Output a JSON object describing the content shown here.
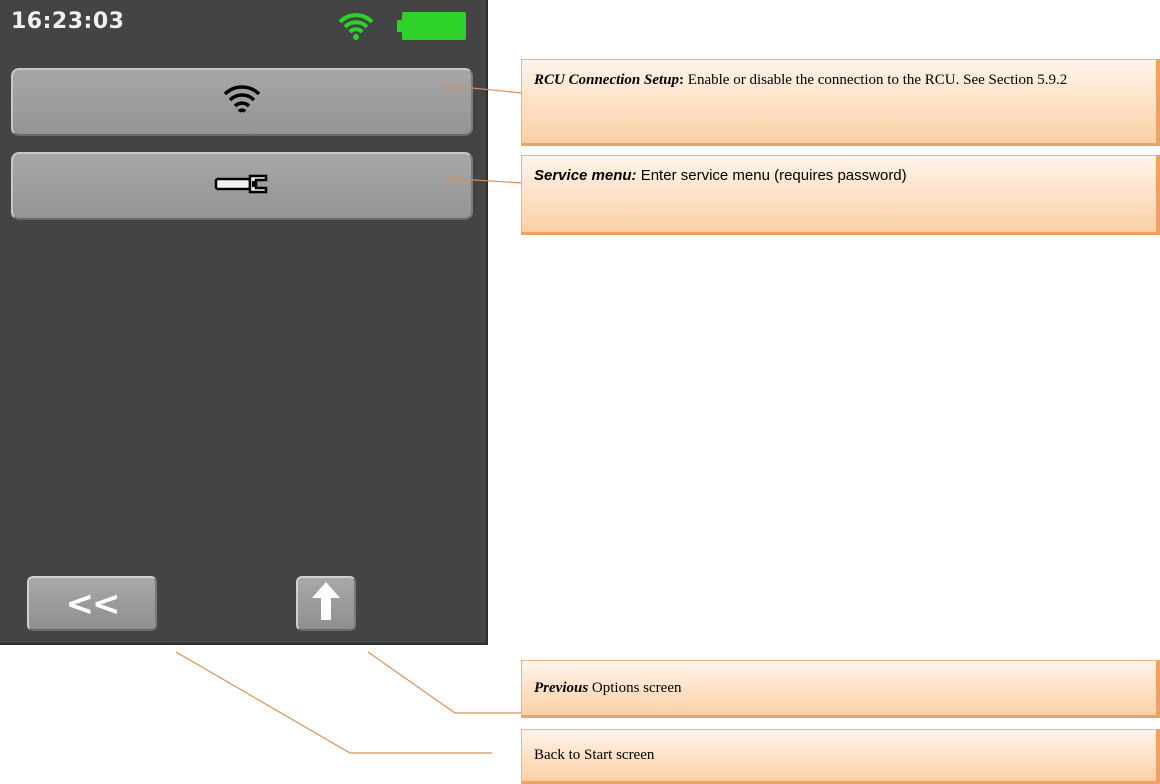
{
  "status_bar": {
    "time": "16:23:03",
    "wifi_icon": "wifi-icon",
    "battery_icon": "battery-icon",
    "accent_color": "#2fd22a"
  },
  "menu": {
    "items": [
      {
        "icon": "wifi-icon"
      },
      {
        "icon": "wrench-icon"
      }
    ]
  },
  "nav": {
    "back_label": "<<",
    "up_icon": "arrow-up-icon"
  },
  "callouts": {
    "rcu": {
      "title": "RCU Connection Setup",
      "sep": ":",
      "text": " Enable or disable the connection to the RCU. See Section 5.9.2"
    },
    "service": {
      "title": "Service menu:",
      "text": " Enter service menu (requires password)"
    },
    "previous": {
      "title": "Previous",
      "text": " Options screen"
    },
    "back": {
      "text": "Back to Start screen"
    }
  },
  "colors": {
    "screen_bg": "#444444",
    "callout_border": "#f0a060",
    "connector_line": "#d99058"
  }
}
